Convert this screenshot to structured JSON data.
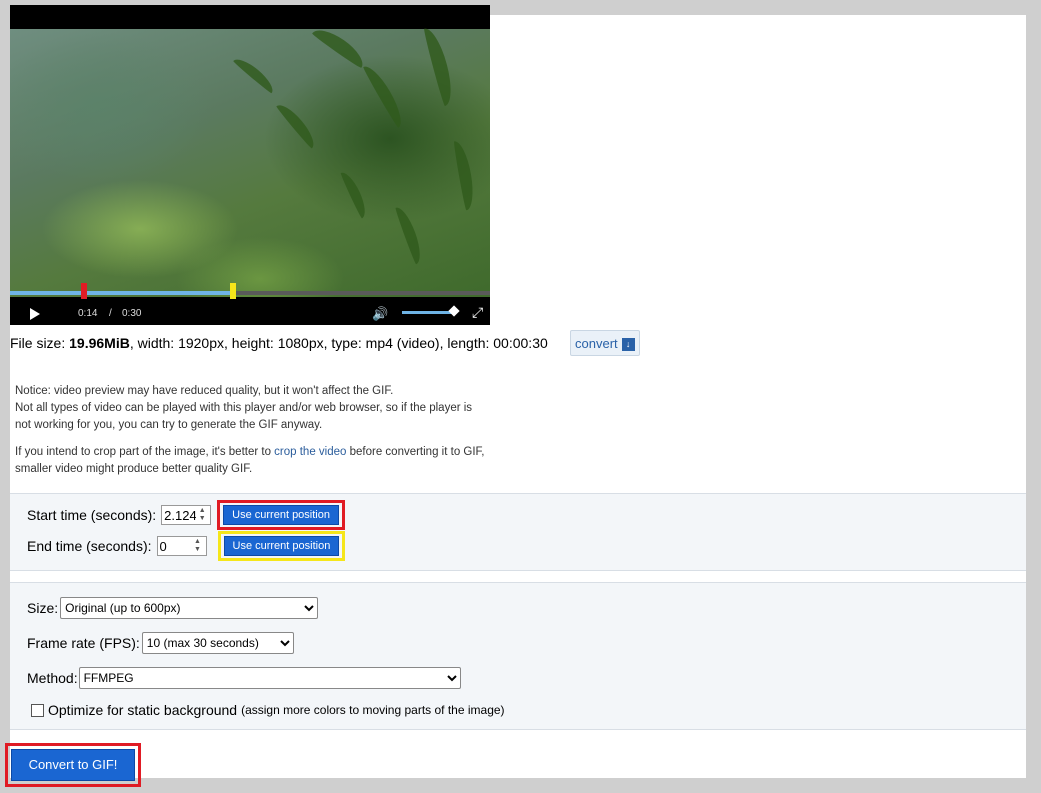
{
  "player": {
    "current_time": "0:14",
    "separator": "/",
    "duration": "0:30",
    "progress": 0.46,
    "start_marker": 0.155,
    "end_marker": 0.465,
    "volume": 0.9,
    "icons": [
      "play-icon",
      "volume-icon",
      "fullscreen-icon"
    ]
  },
  "fileinfo": {
    "prefix": "File size: ",
    "size": "19.96MiB",
    "details": ", width: 1920px, height: 1080px, type: mp4 (video), length: 00:00:30",
    "convert_label": "convert"
  },
  "notice": {
    "line1": "Notice: video preview may have reduced quality, but it won't affect the GIF.",
    "line2": "Not all types of video can be played with this player and/or web browser, so if the player is",
    "line3": "not working for you, you can try to generate the GIF anyway.",
    "crop_pre": "If you intend to crop part of the image, it's better to ",
    "crop_link": "crop the video",
    "crop_post": " before converting it to GIF,",
    "crop_line2": "smaller video might produce better quality GIF."
  },
  "time": {
    "start_label": "Start time (seconds):",
    "start_value": "2.124",
    "end_label": "End time (seconds):",
    "end_value": "0",
    "use_current_label": "Use current position"
  },
  "options": {
    "size_label": "Size:",
    "size_value": "Original (up to 600px)",
    "fps_label": "Frame rate (FPS):",
    "fps_value": "10 (max 30 seconds)",
    "method_label": "Method:",
    "method_value": "FFMPEG",
    "optimize_label": "Optimize for static background",
    "optimize_note": "(assign more colors to moving parts of the image)",
    "optimize_checked": false
  },
  "convert_button": "Convert to GIF!",
  "colors": {
    "highlight_red": "#e01b24",
    "highlight_yellow": "#f5e61a",
    "button_blue": "#1a66d2"
  }
}
